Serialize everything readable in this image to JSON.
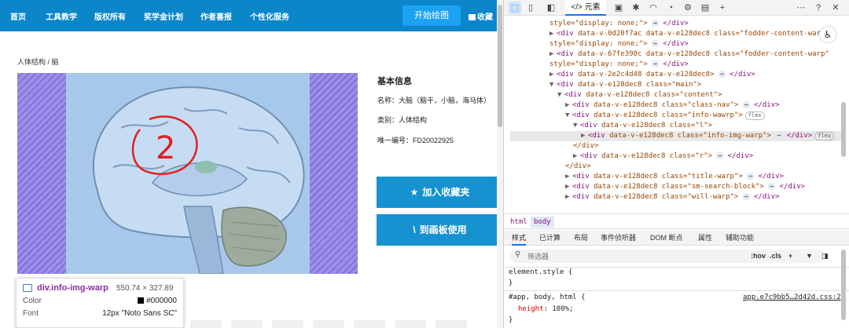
{
  "nav": {
    "items": [
      "首页",
      "工具教学",
      "版权所有",
      "奖学金计划",
      "作者喜报",
      "个性化服务"
    ],
    "start_button": "开始绘图",
    "fav_link": "收藏"
  },
  "breadcrumb": "人体结构 / 脑",
  "info": {
    "title": "基本信息",
    "name": "名称：大脑（脑干，小脑，海马体）",
    "category": "类别：人体结构",
    "id": "唯一编号：FD20022925"
  },
  "buttons": {
    "add_favorite": "加入收藏夹",
    "to_canvas": "到画板使用"
  },
  "annotation": {
    "number": "2"
  },
  "tooltip": {
    "selector": "div.info-img-warp",
    "size": "550.74 × 327.89",
    "color_label": "Color",
    "color_value": "#000000",
    "font_label": "Font",
    "font_value": "12px \"Noto Sans SC\""
  },
  "devtools": {
    "elements_tab": "元素",
    "dom_lines": [
      {
        "indent": 0,
        "arrow": "",
        "html": "style=\"display: none;\">",
        "ellipsis": true,
        "close": "</div>"
      },
      {
        "indent": 1,
        "arrow": "▶",
        "tag": "div",
        "attrs": "data-v-0d20f7ac data-v-e128dec8 class=\"fodder-content-warp\"",
        "ellipsis": false,
        "close": ""
      },
      {
        "indent": 0,
        "arrow": "",
        "html": "style=\"display: none;\">",
        "ellipsis": true,
        "close": "</div>"
      },
      {
        "indent": 1,
        "arrow": "▶",
        "tag": "div",
        "attrs": "data-v-67fe398c data-v-e128dec8 class=\"fodder-content-warp\"",
        "ellipsis": false,
        "close": ""
      },
      {
        "indent": 0,
        "arrow": "",
        "html": "style=\"display: none;\">",
        "ellipsis": true,
        "close": "</div>"
      },
      {
        "indent": 1,
        "arrow": "▶",
        "tag": "div",
        "attrs": "data-v-2e2c4d48 data-v-e128dec8>",
        "ellipsis": true,
        "close": "</div>"
      },
      {
        "indent": 1,
        "arrow": "▼",
        "tag": "div",
        "attrs": "data-v-e128dec8 class=\"main\">",
        "ellipsis": false,
        "close": ""
      },
      {
        "indent": 2,
        "arrow": "▼",
        "tag": "div",
        "attrs": "data-v-e128dec8 class=\"content\">",
        "ellipsis": false,
        "close": ""
      },
      {
        "indent": 3,
        "arrow": "▶",
        "tag": "div",
        "attrs": "data-v-e128dec8 class=\"class-nav\">",
        "ellipsis": true,
        "close": "</div>"
      },
      {
        "indent": 3,
        "arrow": "▼",
        "tag": "div",
        "attrs": "data-v-e128dec8 class=\"info-wawrp\">",
        "ellipsis": false,
        "close": "",
        "badge": "flex"
      },
      {
        "indent": 4,
        "arrow": "▼",
        "tag": "div",
        "attrs": "data-v-e128dec8 class=\"l\">",
        "ellipsis": false,
        "close": ""
      },
      {
        "indent": 5,
        "arrow": "▶",
        "tag": "div",
        "attrs": "data-v-e128dec8 class=\"info-img-warp\">",
        "ellipsis": true,
        "close": "</div>",
        "badge": "flex",
        "selected": true
      },
      {
        "indent": 4,
        "arrow": "",
        "html": "</div>",
        "ellipsis": false,
        "close": ""
      },
      {
        "indent": 4,
        "arrow": "▶",
        "tag": "div",
        "attrs": "data-v-e128dec8 class=\"r\">",
        "ellipsis": true,
        "close": "</div>"
      },
      {
        "indent": 3,
        "arrow": "",
        "html": "</div>",
        "ellipsis": false,
        "close": ""
      },
      {
        "indent": 3,
        "arrow": "▶",
        "tag": "div",
        "attrs": "data-v-e128dec8 class=\"title-warp\">",
        "ellipsis": true,
        "close": "</div>"
      },
      {
        "indent": 3,
        "arrow": "▶",
        "tag": "div",
        "attrs": "data-v-e128dec8 class=\"sm-search-block\">",
        "ellipsis": true,
        "close": "</div>"
      },
      {
        "indent": 3,
        "arrow": "▶",
        "tag": "div",
        "attrs": "data-v-e128dec8 class=\"will-warp\">",
        "ellipsis": true,
        "close": "</div>"
      }
    ],
    "crumbs": [
      "html",
      "body"
    ],
    "style_tabs": [
      "样式",
      "已计算",
      "布局",
      "事件侦听器",
      "DOM 断点",
      "属性",
      "辅助功能"
    ],
    "filter_placeholder": "筛选器",
    "filter_tools": [
      ":hov",
      ".cls"
    ],
    "rule1_selector": "element.style {",
    "rule1_close": "}",
    "rule2_selector": "#app, body, html {",
    "rule2_source": "app.e7c9bb5…2d42d.css:2",
    "rule2_prop": "height",
    "rule2_value": ": 100%;",
    "rule2_close": "}"
  },
  "colors": {
    "nav_bg": "#0a86c9",
    "button_bg": "#1592cf",
    "annotation": "#e02020"
  }
}
